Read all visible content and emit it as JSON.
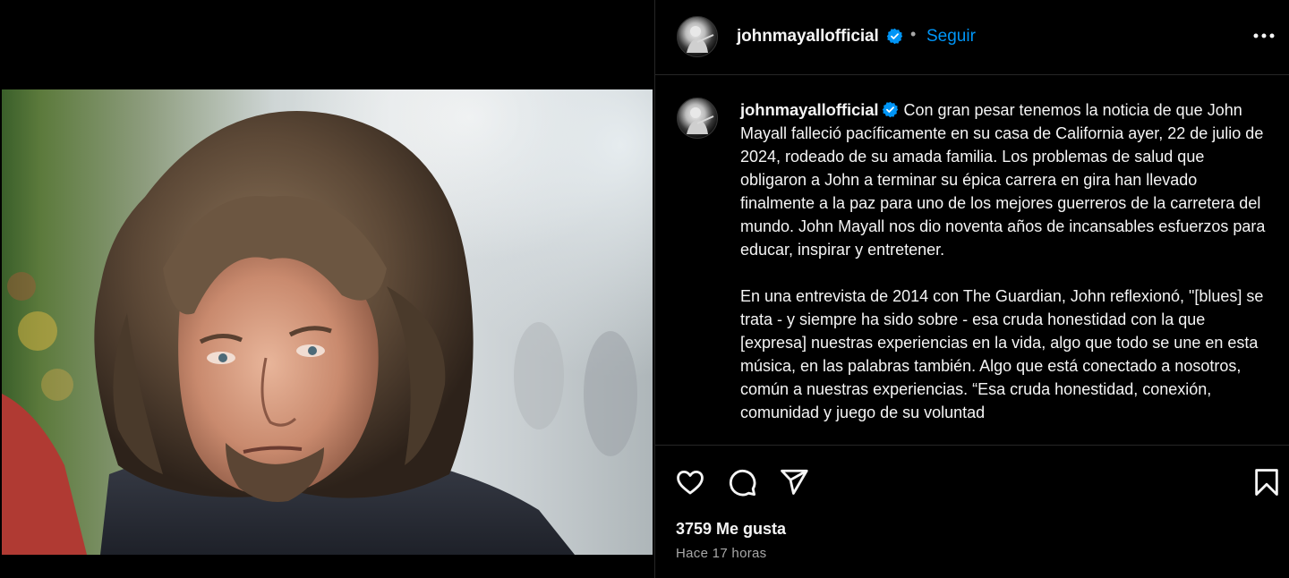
{
  "post": {
    "photo_alt": "Portrait photo",
    "author": {
      "username": "johnmayallofficial",
      "verified": true
    },
    "header": {
      "separator": "•",
      "follow_label": "Seguir"
    },
    "caption": {
      "username": "johnmayallofficial",
      "paragraph_1": "Con gran pesar tenemos la noticia de que John Mayall falleció pacíficamente en su casa de California ayer, 22 de julio de 2024, rodeado de su amada familia. Los problemas de salud que obligaron a John a terminar su épica carrera en gira han llevado finalmente a la paz para uno de los mejores guerreros de la carretera del mundo. John Mayall nos dio noventa años de incansables esfuerzos para educar, inspirar y entretener.",
      "paragraph_2": "En una entrevista de 2014 con The Guardian, John reflexionó, \"[blues] se trata - y siempre ha sido sobre - esa cruda honestidad con la que [expresa] nuestras experiencias en la vida, algo que todo se une en esta música, en las palabras también. Algo que está conectado a nosotros, común a nuestras experiencias. “Esa cruda honestidad, conexión, comunidad y juego de su voluntad"
    },
    "actions": {
      "like_icon": "heart-icon",
      "comment_icon": "comment-icon",
      "share_icon": "send-icon",
      "save_icon": "bookmark-icon"
    },
    "likes_text": "3759 Me gusta",
    "timestamp": "Hace 17 horas"
  },
  "colors": {
    "background": "#000000",
    "link_blue": "#0095f6",
    "verified_blue": "#0095f6",
    "muted_text": "#a8a8a8",
    "divider": "#262626"
  }
}
